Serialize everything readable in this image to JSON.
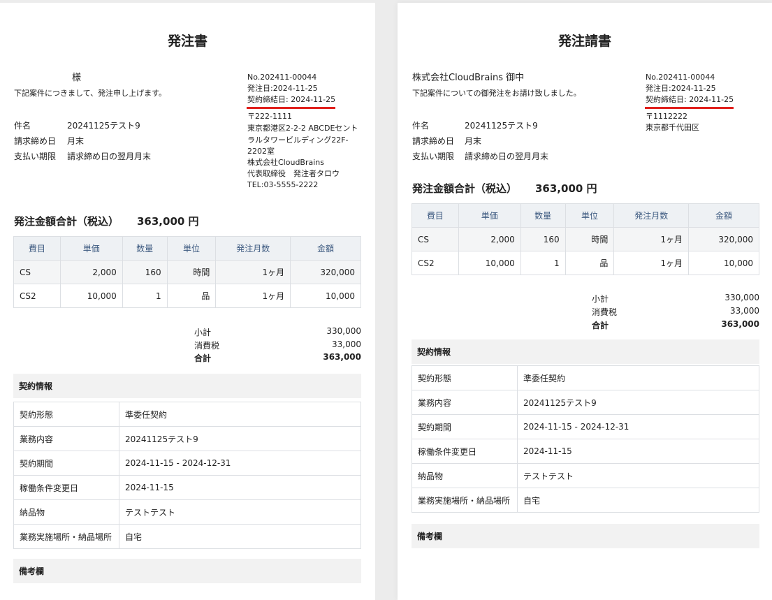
{
  "left": {
    "title": "発注書",
    "recipient": "様",
    "intro": "下記案件につきまして、発注申し上げます。",
    "info": [
      {
        "label": "件名",
        "value": "20241125テスト9"
      },
      {
        "label": "請求締め日",
        "value": "月末"
      },
      {
        "label": "支払い期限",
        "value": "請求締め日の翌月月末"
      }
    ],
    "no": "No.202411-00044",
    "order_date": "発注日:2024-11-25",
    "contract_date": "契約締結日: 2024-11-25",
    "postal": "〒222-1111",
    "address": "東京都港区2-2-2 ABCDEセントラルタワービルディング22F-2202室",
    "company": "株式会社CloudBrains",
    "rep": "代表取締役　発注者タロウ",
    "tel": "TEL:03-5555-2222",
    "total_label": "発注金額合計（税込）",
    "total_value": "363,000 円"
  },
  "right": {
    "title": "発注請書",
    "recipient": "株式会社CloudBrains 御中",
    "intro": "下記案件についての御発注をお請け致しました。",
    "info": [
      {
        "label": "件名",
        "value": "20241125テスト9"
      },
      {
        "label": "請求締め日",
        "value": "月末"
      },
      {
        "label": "支払い期限",
        "value": "請求締め日の翌月月末"
      }
    ],
    "no": "No.202411-00044",
    "order_date": "発注日:2024-11-25",
    "contract_date": "契約締結日: 2024-11-25",
    "postal": "〒1112222",
    "address": "東京都千代田区",
    "total_label": "発注金額合計（税込）",
    "total_value": "363,000 円"
  },
  "items_table": {
    "headers": [
      "費目",
      "単価",
      "数量",
      "単位",
      "発注月数",
      "金額"
    ],
    "rows": [
      [
        "CS",
        "2,000",
        "160",
        "時間",
        "1ヶ月",
        "320,000"
      ],
      [
        "CS2",
        "10,000",
        "1",
        "品",
        "1ヶ月",
        "10,000"
      ]
    ]
  },
  "summary": [
    {
      "label": "小計",
      "value": "330,000"
    },
    {
      "label": "消費税",
      "value": "33,000"
    },
    {
      "label": "合計",
      "value": "363,000"
    }
  ],
  "contract": {
    "heading": "契約情報",
    "rows": [
      {
        "label": "契約形態",
        "value": "準委任契約"
      },
      {
        "label": "業務内容",
        "value": "20241125テスト9"
      },
      {
        "label": "契約期間",
        "value": "2024-11-15 - 2024-12-31"
      },
      {
        "label": "稼働条件変更日",
        "value": "2024-11-15"
      },
      {
        "label": "納品物",
        "value": "テストテスト"
      },
      {
        "label": "業務実施場所・納品場所",
        "value": "自宅"
      }
    ]
  },
  "remarks_heading": "備考欄",
  "colors": {
    "accent_underline": "#e0201c",
    "table_header_text": "#3d5a80",
    "table_header_bg": "#eef1f4"
  }
}
